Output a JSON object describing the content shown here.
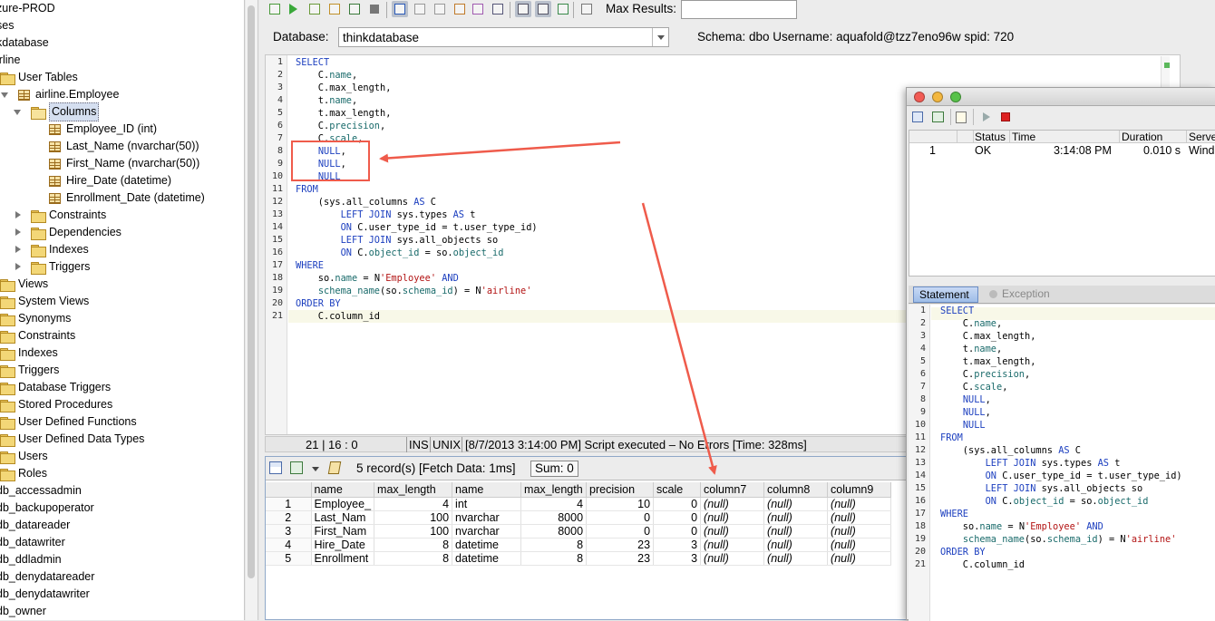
{
  "tree": {
    "items": [
      {
        "label": "zure-PROD",
        "indent": 0,
        "icon": "none",
        "arrow": "none"
      },
      {
        "label": "ses",
        "indent": 0,
        "icon": "none",
        "arrow": "none"
      },
      {
        "label": "kdatabase",
        "indent": 0,
        "icon": "none",
        "arrow": "none"
      },
      {
        "label": "irline",
        "indent": 0,
        "icon": "none",
        "arrow": "none"
      },
      {
        "label": "User Tables",
        "indent": 0,
        "icon": "folder",
        "arrow": "none"
      },
      {
        "label": "airline.Employee",
        "indent": 1,
        "icon": "grid",
        "arrow": "down"
      },
      {
        "label": "Columns",
        "indent": 2,
        "icon": "folder-open",
        "arrow": "down",
        "selected": true
      },
      {
        "label": "Employee_ID (int)",
        "indent": 3,
        "icon": "grid",
        "arrow": "none"
      },
      {
        "label": "Last_Name (nvarchar(50))",
        "indent": 3,
        "icon": "grid",
        "arrow": "none"
      },
      {
        "label": "First_Name (nvarchar(50))",
        "indent": 3,
        "icon": "grid",
        "arrow": "none"
      },
      {
        "label": "Hire_Date (datetime)",
        "indent": 3,
        "icon": "grid",
        "arrow": "none"
      },
      {
        "label": "Enrollment_Date (datetime)",
        "indent": 3,
        "icon": "grid",
        "arrow": "none"
      },
      {
        "label": "Constraints",
        "indent": 2,
        "icon": "folder",
        "arrow": "right"
      },
      {
        "label": "Dependencies",
        "indent": 2,
        "icon": "folder",
        "arrow": "right"
      },
      {
        "label": "Indexes",
        "indent": 2,
        "icon": "folder",
        "arrow": "right"
      },
      {
        "label": "Triggers",
        "indent": 2,
        "icon": "folder",
        "arrow": "right"
      },
      {
        "label": "Views",
        "indent": 0,
        "icon": "folder",
        "arrow": "none"
      },
      {
        "label": "System Views",
        "indent": 0,
        "icon": "folder",
        "arrow": "none"
      },
      {
        "label": "Synonyms",
        "indent": 0,
        "icon": "folder",
        "arrow": "none"
      },
      {
        "label": "Constraints",
        "indent": 0,
        "icon": "folder",
        "arrow": "none"
      },
      {
        "label": "Indexes",
        "indent": 0,
        "icon": "folder",
        "arrow": "none"
      },
      {
        "label": "Triggers",
        "indent": 0,
        "icon": "folder",
        "arrow": "none"
      },
      {
        "label": "Database Triggers",
        "indent": 0,
        "icon": "folder",
        "arrow": "none"
      },
      {
        "label": "Stored Procedures",
        "indent": 0,
        "icon": "folder",
        "arrow": "none"
      },
      {
        "label": "User Defined Functions",
        "indent": 0,
        "icon": "folder",
        "arrow": "none"
      },
      {
        "label": "User Defined Data Types",
        "indent": 0,
        "icon": "folder",
        "arrow": "none"
      },
      {
        "label": "Users",
        "indent": 0,
        "icon": "folder",
        "arrow": "none"
      },
      {
        "label": "Roles",
        "indent": 0,
        "icon": "folder",
        "arrow": "none"
      },
      {
        "label": "db_accessadmin",
        "indent": 0,
        "icon": "none",
        "arrow": "none"
      },
      {
        "label": "db_backupoperator",
        "indent": 0,
        "icon": "none",
        "arrow": "none"
      },
      {
        "label": "db_datareader",
        "indent": 0,
        "icon": "none",
        "arrow": "none"
      },
      {
        "label": "db_datawriter",
        "indent": 0,
        "icon": "none",
        "arrow": "none"
      },
      {
        "label": "db_ddladmin",
        "indent": 0,
        "icon": "none",
        "arrow": "none"
      },
      {
        "label": "db_denydatareader",
        "indent": 0,
        "icon": "none",
        "arrow": "none"
      },
      {
        "label": "db_denydatawriter",
        "indent": 0,
        "icon": "none",
        "arrow": "none"
      },
      {
        "label": "db_owner",
        "indent": 0,
        "icon": "none",
        "arrow": "none"
      }
    ]
  },
  "toolbar": {
    "icons": [
      "run-all-icon",
      "run-icon",
      "run-current-icon",
      "explain-icon",
      "export-icon",
      "stop-icon",
      "commit-icon",
      "back-icon",
      "forward-icon",
      "format-icon",
      "bookmark-icon",
      "tools-icon",
      "grid-view-icon",
      "text-view-icon",
      "history-icon",
      "settings-icon"
    ],
    "max_results_label": "Max Results:",
    "max_results_value": ""
  },
  "connection": {
    "database_label": "Database:",
    "database_value": "thinkdatabase",
    "schema_text": "Schema:  dbo     Username:  aquafold@tzz7eno96w     spid:  720"
  },
  "editor": {
    "line_numbers": [
      "1",
      "2",
      "3",
      "4",
      "5",
      "6",
      "7",
      "8",
      "9",
      "10",
      "11",
      "12",
      "13",
      "14",
      "15",
      "16",
      "17",
      "18",
      "19",
      "20",
      "21"
    ]
  },
  "status": {
    "position": "21 | 16 : 0",
    "mode": "INS",
    "line_endings": "UNIX",
    "message": "[8/7/2013 3:14:00 PM] Script executed – No Errors [Time: 328ms]"
  },
  "results": {
    "record_text": "5 record(s) [Fetch Data: 1ms]",
    "sum_text": "Sum: 0",
    "columns": [
      "",
      "name",
      "max_length",
      "name",
      "max_length",
      "precision",
      "scale",
      "column7",
      "column8",
      "column9"
    ],
    "rows": [
      [
        "1",
        "Employee_",
        "4",
        "int",
        "4",
        "10",
        "0",
        "(null)",
        "(null)",
        "(null)"
      ],
      [
        "2",
        "Last_Nam",
        "100",
        "nvarchar",
        "8000",
        "0",
        "0",
        "(null)",
        "(null)",
        "(null)"
      ],
      [
        "3",
        "First_Nam",
        "100",
        "nvarchar",
        "8000",
        "0",
        "0",
        "(null)",
        "(null)",
        "(null)"
      ],
      [
        "4",
        "Hire_Date",
        "8",
        "datetime",
        "8",
        "23",
        "3",
        "(null)",
        "(null)",
        "(null)"
      ],
      [
        "5",
        "Enrollment",
        "8",
        "datetime",
        "8",
        "23",
        "3",
        "(null)",
        "(null)",
        "(null)"
      ]
    ]
  },
  "history": {
    "headers": {
      "status": "Status",
      "time": "Time",
      "duration": "Duration",
      "server": "Serve"
    },
    "row": {
      "num": "1",
      "status": "OK",
      "time": "3:14:08 PM",
      "duration": "0.010 s",
      "server": "Windo"
    }
  },
  "statement_window": {
    "tab_statement": "Statement",
    "tab_exception": "Exception"
  },
  "colors": {
    "keyword": "#1c3fbf",
    "function": "#1a6b6b",
    "string": "#b31515",
    "annotation": "#ef5b4b"
  }
}
